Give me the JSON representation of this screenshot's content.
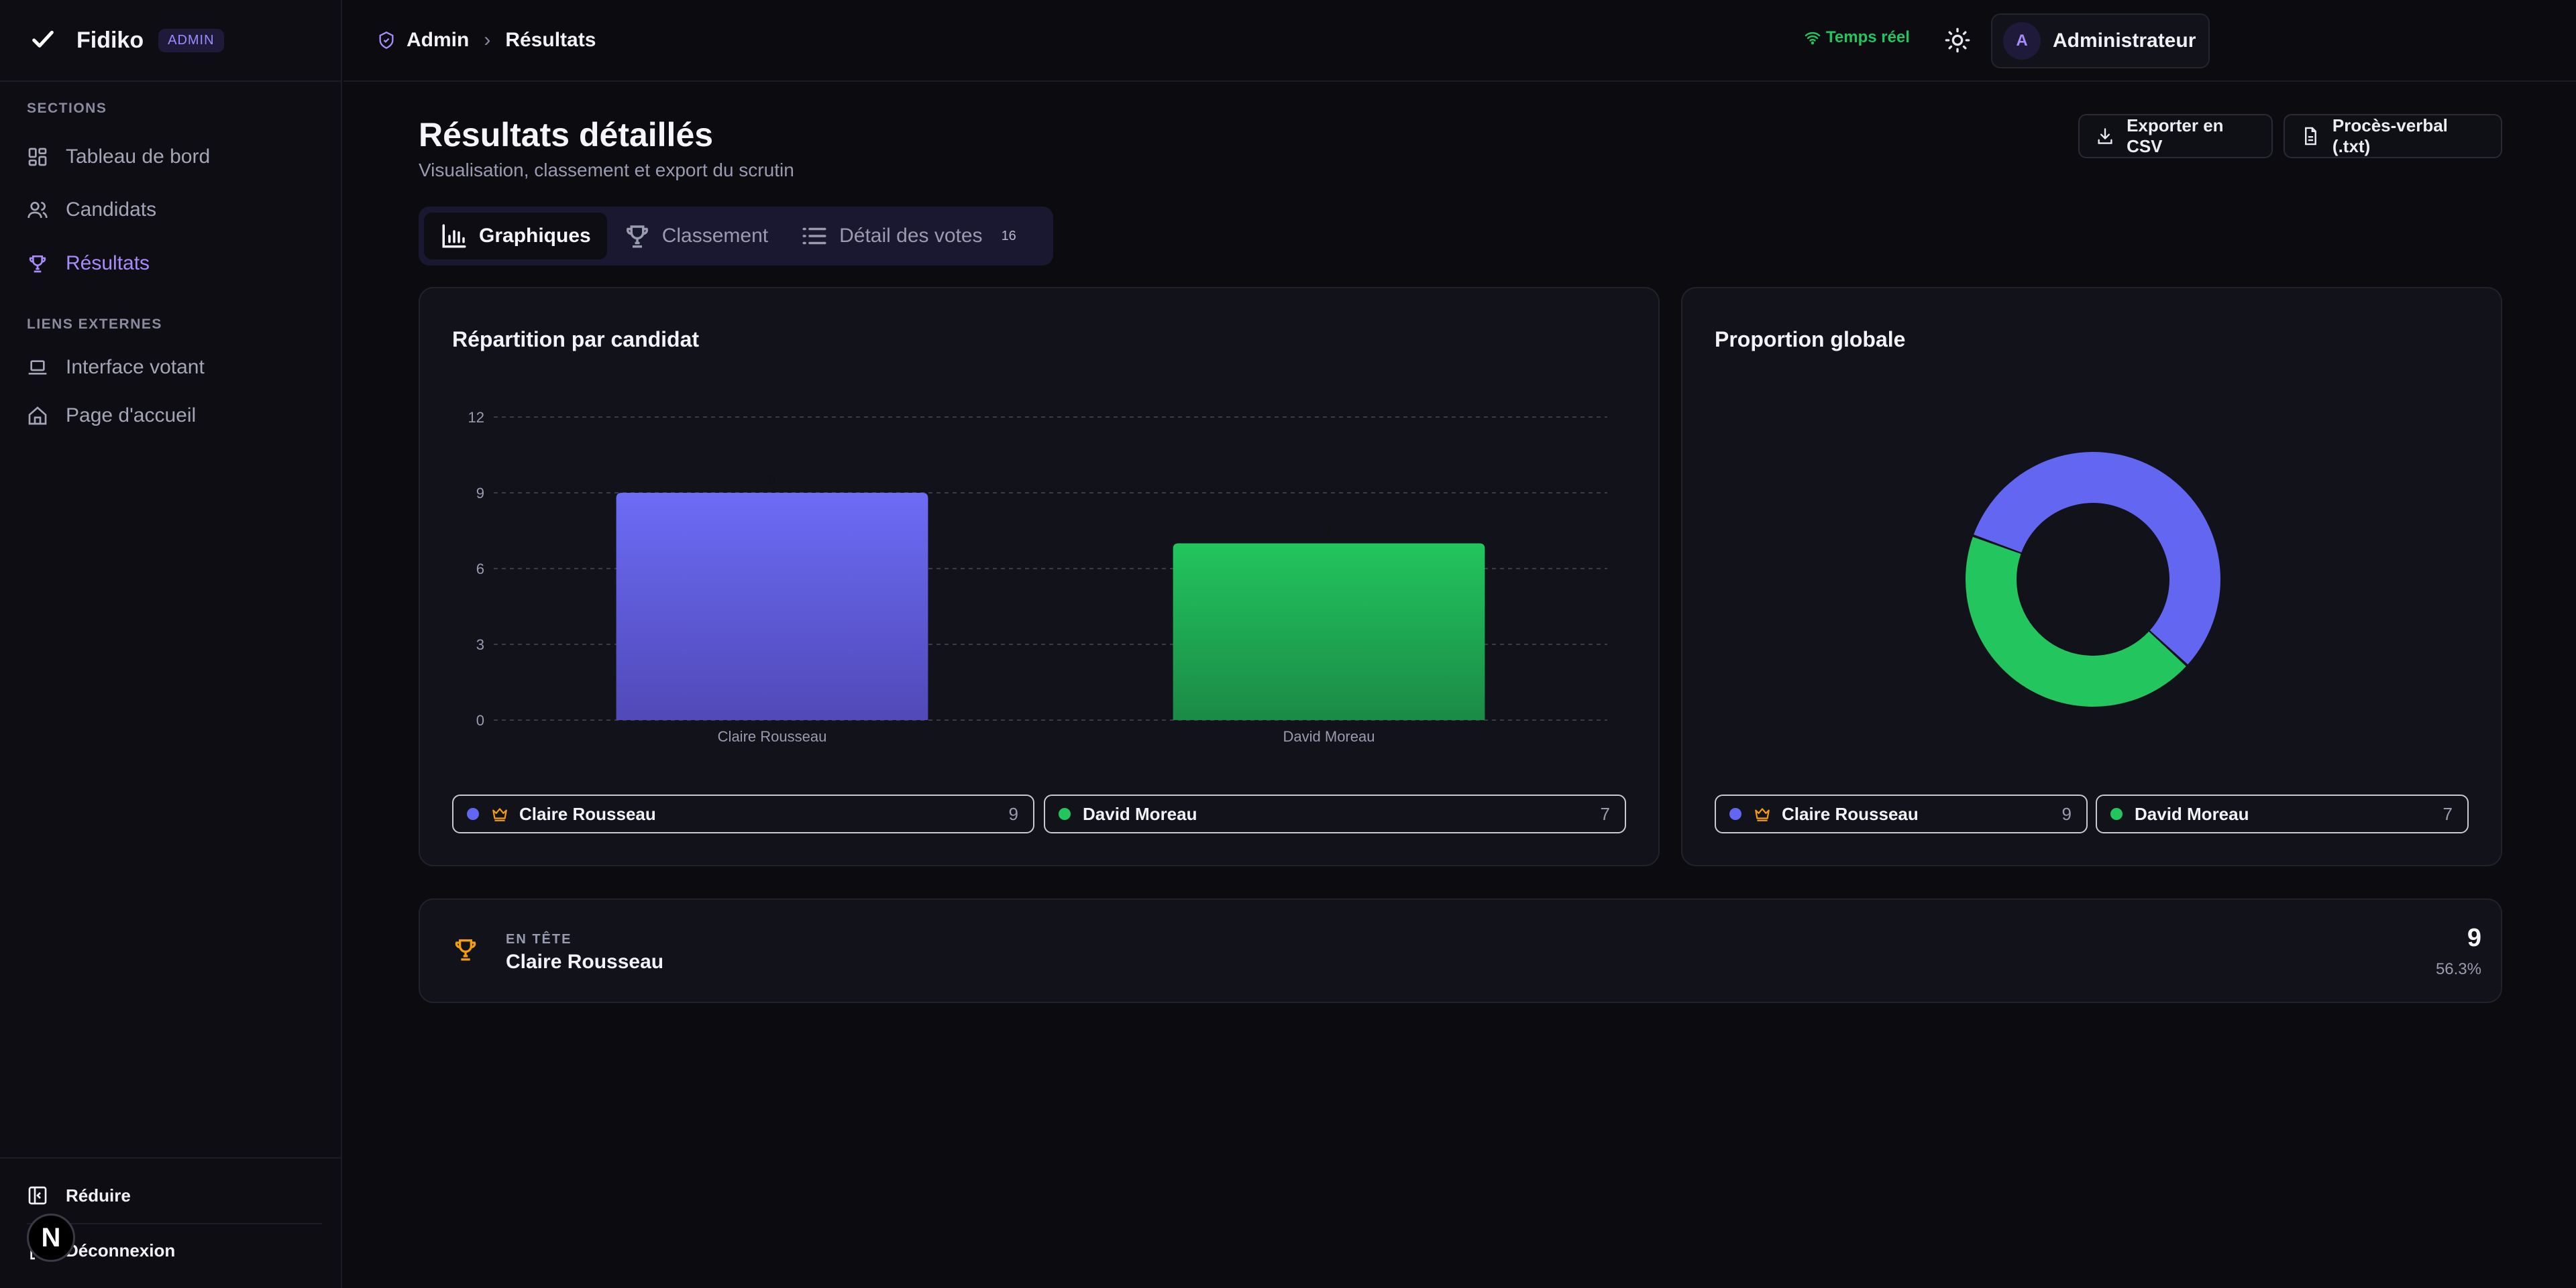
{
  "brand": {
    "name": "Fidiko",
    "badge": "ADMIN"
  },
  "sidebar": {
    "section_label": "SECTIONS",
    "items": [
      {
        "label": "Tableau de bord",
        "icon": "dashboard-icon"
      },
      {
        "label": "Candidats",
        "icon": "users-icon"
      },
      {
        "label": "Résultats",
        "icon": "trophy-icon",
        "active": true
      }
    ],
    "external_label": "LIENS EXTERNES",
    "external_items": [
      {
        "label": "Interface votant",
        "icon": "laptop-icon"
      },
      {
        "label": "Page d'accueil",
        "icon": "home-icon"
      }
    ],
    "collapse_label": "Réduire",
    "logout_label": "Déconnexion",
    "n_badge": "N"
  },
  "topbar": {
    "breadcrumb": {
      "root": "Admin",
      "current": "Résultats"
    },
    "live_label": "Temps réel",
    "user": {
      "initial": "A",
      "name": "Administrateur"
    }
  },
  "page": {
    "title": "Résultats détaillés",
    "subtitle": "Visualisation, classement et export du scrutin",
    "export_csv": "Exporter en CSV",
    "export_pv": "Procès-verbal (.txt)"
  },
  "tabs": [
    {
      "label": "Graphiques",
      "icon": "bar-chart-icon",
      "active": true
    },
    {
      "label": "Classement",
      "icon": "trophy-icon"
    },
    {
      "label": "Détail des votes",
      "icon": "list-icon",
      "count": "16"
    }
  ],
  "bar_card": {
    "title": "Répartition par candidat"
  },
  "pie_card": {
    "title": "Proportion globale"
  },
  "chart_data": [
    {
      "type": "bar",
      "title": "Répartition par candidat",
      "categories": [
        "Claire Rousseau",
        "David Moreau"
      ],
      "values": [
        9,
        7
      ],
      "data_labels": [
        "9",
        "7"
      ],
      "colors": [
        "#6366f1",
        "#22c55e"
      ],
      "ylim": [
        0,
        12
      ],
      "yticks": [
        "0",
        "3",
        "6",
        "9",
        "12"
      ],
      "grid": true
    },
    {
      "type": "pie",
      "title": "Proportion globale",
      "categories": [
        "Claire Rousseau",
        "David Moreau"
      ],
      "values": [
        9,
        7
      ],
      "colors": [
        "#6366f1",
        "#22c55e"
      ]
    }
  ],
  "legend": [
    {
      "name": "Claire Rousseau",
      "value": "9",
      "color": "#6366f1",
      "leader": true
    },
    {
      "name": "David Moreau",
      "value": "7",
      "color": "#22c55e",
      "leader": false
    }
  ],
  "leader": {
    "eyebrow": "EN TÊTE",
    "name": "Claire Rousseau",
    "count": "9",
    "percent": "56.3%"
  }
}
